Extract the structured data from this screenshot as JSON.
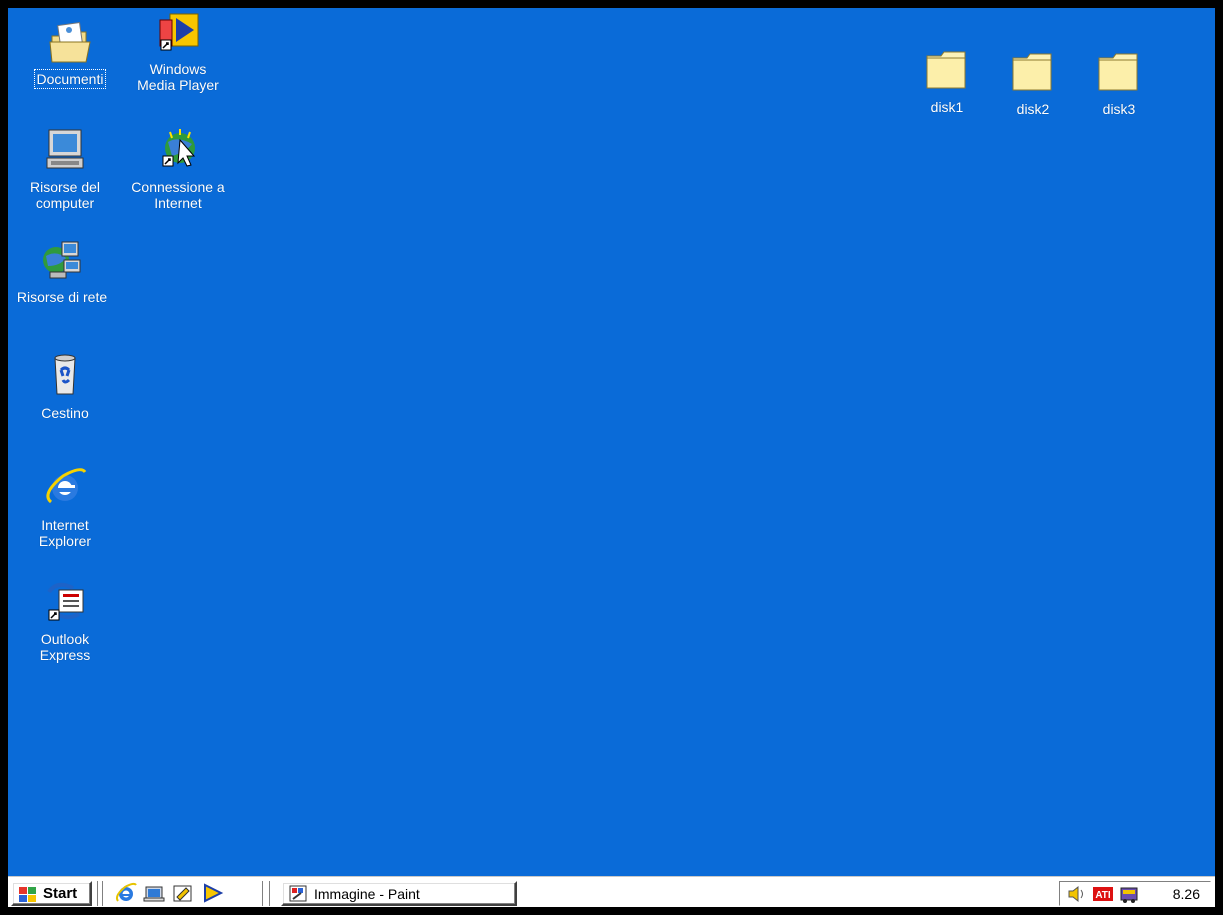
{
  "desktop": {
    "background_color": "#0a6bd8",
    "icons_left": [
      {
        "id": "documenti",
        "label": "Documenti",
        "icon": "folder-documents-icon"
      },
      {
        "id": "wmp",
        "label": "Windows\nMedia Player",
        "icon": "media-player-icon"
      },
      {
        "id": "risorse-computer",
        "label": "Risorse del\ncomputer",
        "icon": "my-computer-icon"
      },
      {
        "id": "connessione",
        "label": "Connessione a\nInternet",
        "icon": "connection-wizard-icon"
      },
      {
        "id": "risorse-rete",
        "label": "Risorse di rete",
        "icon": "network-icon"
      },
      {
        "id": "cestino",
        "label": "Cestino",
        "icon": "recycle-bin-icon"
      },
      {
        "id": "ie",
        "label": "Internet\nExplorer",
        "icon": "internet-explorer-icon"
      },
      {
        "id": "outlook",
        "label": "Outlook\nExpress",
        "icon": "outlook-express-icon"
      }
    ],
    "folders": [
      {
        "label": "disk1",
        "icon": "folder-icon"
      },
      {
        "label": "disk2",
        "icon": "folder-icon"
      },
      {
        "label": "disk3",
        "icon": "folder-icon"
      }
    ]
  },
  "taskbar": {
    "start_label": "Start",
    "quick_launch": [
      "internet-explorer-icon",
      "show-desktop-icon",
      "outlook-icon",
      "media-player-icon"
    ],
    "tasks": [
      {
        "label": "Immagine - Paint",
        "icon": "paint-icon"
      }
    ],
    "tray": {
      "icons": [
        "volume-icon",
        "ati-icon",
        "task-scheduler-icon"
      ],
      "clock": "8.26"
    }
  }
}
